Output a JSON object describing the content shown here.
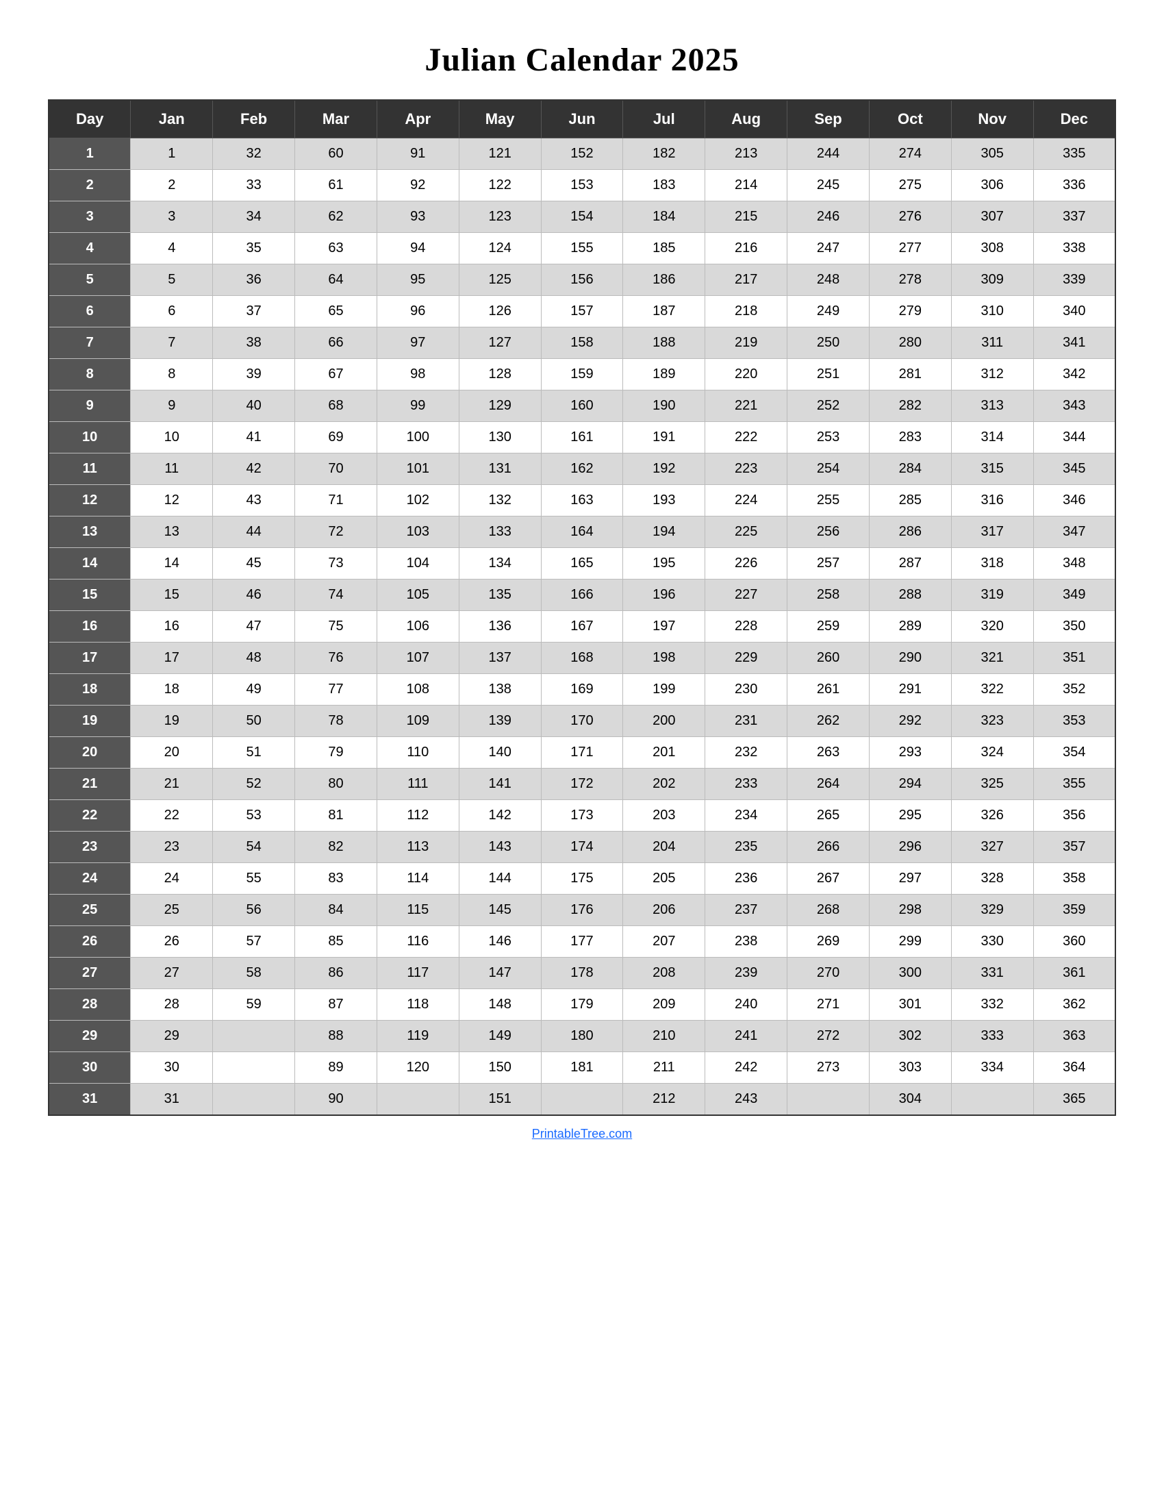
{
  "title": "Julian Calendar 2025",
  "footer": "PrintableTree.com",
  "headers": [
    "Day",
    "Jan",
    "Feb",
    "Mar",
    "Apr",
    "May",
    "Jun",
    "Jul",
    "Aug",
    "Sep",
    "Oct",
    "Nov",
    "Dec"
  ],
  "rows": [
    [
      1,
      1,
      32,
      60,
      91,
      121,
      152,
      182,
      213,
      244,
      274,
      305,
      335
    ],
    [
      2,
      2,
      33,
      61,
      92,
      122,
      153,
      183,
      214,
      245,
      275,
      306,
      336
    ],
    [
      3,
      3,
      34,
      62,
      93,
      123,
      154,
      184,
      215,
      246,
      276,
      307,
      337
    ],
    [
      4,
      4,
      35,
      63,
      94,
      124,
      155,
      185,
      216,
      247,
      277,
      308,
      338
    ],
    [
      5,
      5,
      36,
      64,
      95,
      125,
      156,
      186,
      217,
      248,
      278,
      309,
      339
    ],
    [
      6,
      6,
      37,
      65,
      96,
      126,
      157,
      187,
      218,
      249,
      279,
      310,
      340
    ],
    [
      7,
      7,
      38,
      66,
      97,
      127,
      158,
      188,
      219,
      250,
      280,
      311,
      341
    ],
    [
      8,
      8,
      39,
      67,
      98,
      128,
      159,
      189,
      220,
      251,
      281,
      312,
      342
    ],
    [
      9,
      9,
      40,
      68,
      99,
      129,
      160,
      190,
      221,
      252,
      282,
      313,
      343
    ],
    [
      10,
      10,
      41,
      69,
      100,
      130,
      161,
      191,
      222,
      253,
      283,
      314,
      344
    ],
    [
      11,
      11,
      42,
      70,
      101,
      131,
      162,
      192,
      223,
      254,
      284,
      315,
      345
    ],
    [
      12,
      12,
      43,
      71,
      102,
      132,
      163,
      193,
      224,
      255,
      285,
      316,
      346
    ],
    [
      13,
      13,
      44,
      72,
      103,
      133,
      164,
      194,
      225,
      256,
      286,
      317,
      347
    ],
    [
      14,
      14,
      45,
      73,
      104,
      134,
      165,
      195,
      226,
      257,
      287,
      318,
      348
    ],
    [
      15,
      15,
      46,
      74,
      105,
      135,
      166,
      196,
      227,
      258,
      288,
      319,
      349
    ],
    [
      16,
      16,
      47,
      75,
      106,
      136,
      167,
      197,
      228,
      259,
      289,
      320,
      350
    ],
    [
      17,
      17,
      48,
      76,
      107,
      137,
      168,
      198,
      229,
      260,
      290,
      321,
      351
    ],
    [
      18,
      18,
      49,
      77,
      108,
      138,
      169,
      199,
      230,
      261,
      291,
      322,
      352
    ],
    [
      19,
      19,
      50,
      78,
      109,
      139,
      170,
      200,
      231,
      262,
      292,
      323,
      353
    ],
    [
      20,
      20,
      51,
      79,
      110,
      140,
      171,
      201,
      232,
      263,
      293,
      324,
      354
    ],
    [
      21,
      21,
      52,
      80,
      111,
      141,
      172,
      202,
      233,
      264,
      294,
      325,
      355
    ],
    [
      22,
      22,
      53,
      81,
      112,
      142,
      173,
      203,
      234,
      265,
      295,
      326,
      356
    ],
    [
      23,
      23,
      54,
      82,
      113,
      143,
      174,
      204,
      235,
      266,
      296,
      327,
      357
    ],
    [
      24,
      24,
      55,
      83,
      114,
      144,
      175,
      205,
      236,
      267,
      297,
      328,
      358
    ],
    [
      25,
      25,
      56,
      84,
      115,
      145,
      176,
      206,
      237,
      268,
      298,
      329,
      359
    ],
    [
      26,
      26,
      57,
      85,
      116,
      146,
      177,
      207,
      238,
      269,
      299,
      330,
      360
    ],
    [
      27,
      27,
      58,
      86,
      117,
      147,
      178,
      208,
      239,
      270,
      300,
      331,
      361
    ],
    [
      28,
      28,
      59,
      87,
      118,
      148,
      179,
      209,
      240,
      271,
      301,
      332,
      362
    ],
    [
      29,
      29,
      null,
      88,
      119,
      149,
      180,
      210,
      241,
      272,
      302,
      333,
      363
    ],
    [
      30,
      30,
      null,
      89,
      120,
      150,
      181,
      211,
      242,
      273,
      303,
      334,
      364
    ],
    [
      31,
      31,
      null,
      90,
      null,
      151,
      null,
      212,
      243,
      null,
      304,
      null,
      365
    ]
  ],
  "colors": {
    "header_bg": "#333333",
    "header_text": "#ffffff",
    "day_col_bg": "#555555",
    "day_col_text": "#ffffff",
    "odd_row_bg": "#d9d9d9",
    "even_row_bg": "#ffffff",
    "border": "#bbbbbb",
    "footer_link": "#1a6aff"
  }
}
